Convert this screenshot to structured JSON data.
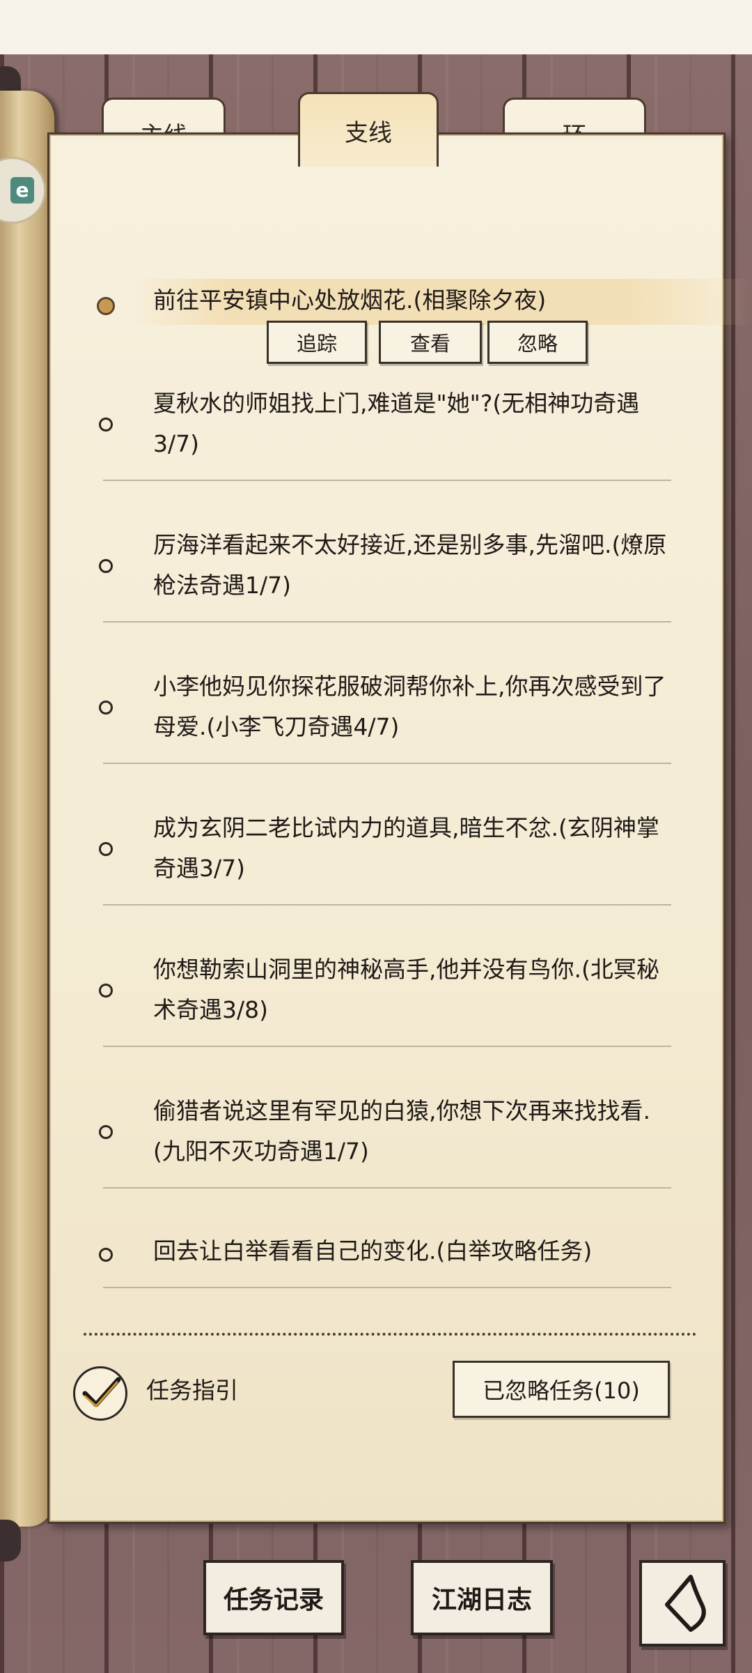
{
  "tabs": [
    {
      "label": "主线",
      "active": false
    },
    {
      "label": "支线",
      "active": true
    },
    {
      "label": "环",
      "active": false
    }
  ],
  "active_task": {
    "text": "前往平安镇中心处放烟花.(相聚除夕夜)",
    "actions": [
      "追踪",
      "查看",
      "忽略"
    ]
  },
  "tasks": [
    {
      "text": "夏秋水的师姐找上门,难道是\"她\"?(无相神功奇遇3/7)"
    },
    {
      "text": "厉海洋看起来不太好接近,还是别多事,先溜吧.(燎原枪法奇遇1/7)"
    },
    {
      "text": "小李他妈见你探花服破洞帮你补上,你再次感受到了母爱.(小李飞刀奇遇4/7)"
    },
    {
      "text": "成为玄阴二老比试内力的道具,暗生不忿.(玄阴神掌奇遇3/7)"
    },
    {
      "text": "你想勒索山洞里的神秘高手,他并没有鸟你.(北冥秘术奇遇3/8)"
    },
    {
      "text": "偷猎者说这里有罕见的白猿,你想下次再来找找看.(九阳不灭功奇遇1/7)"
    },
    {
      "text": "回去让白举看看自己的变化.(白举攻略任务)"
    }
  ],
  "footer": {
    "guide_label": "任务指引",
    "guide_checked": true,
    "ignored_button": "已忽略任务(10)"
  },
  "bottom_nav": {
    "record": "任务记录",
    "journal": "江湖日志",
    "back_icon": "back-arrow-icon"
  },
  "logo_letter": "e"
}
